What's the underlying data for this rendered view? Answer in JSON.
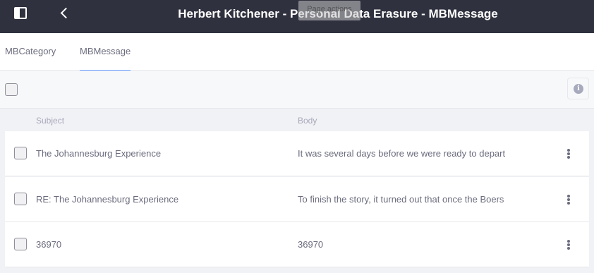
{
  "header": {
    "title": "Herbert Kitchener - Personal Data Erasure - MBMessage",
    "tooltip": "Page actions"
  },
  "tabs": [
    {
      "label": "MBCategory",
      "active": false
    },
    {
      "label": "MBMessage",
      "active": true
    }
  ],
  "table": {
    "columns": [
      "Subject",
      "Body"
    ],
    "rows": [
      {
        "subject": "The Johannesburg Experience",
        "body": "It was several days before we were ready to depart"
      },
      {
        "subject": "RE: The Johannesburg Experience",
        "body": "To finish the story, it turned out that once the Boers"
      },
      {
        "subject": "36970",
        "body": "36970"
      }
    ]
  },
  "icons": {
    "sidebar_toggle": "sidebar-toggle-icon",
    "back": "chevron-left-icon",
    "info": "info-circle-icon",
    "row_actions": "ellipsis-vertical-icon"
  },
  "colors": {
    "topbar": "#30313f",
    "text": "#6b6c7e",
    "muted": "#a7a9bc",
    "accent": "#0b5fff"
  }
}
